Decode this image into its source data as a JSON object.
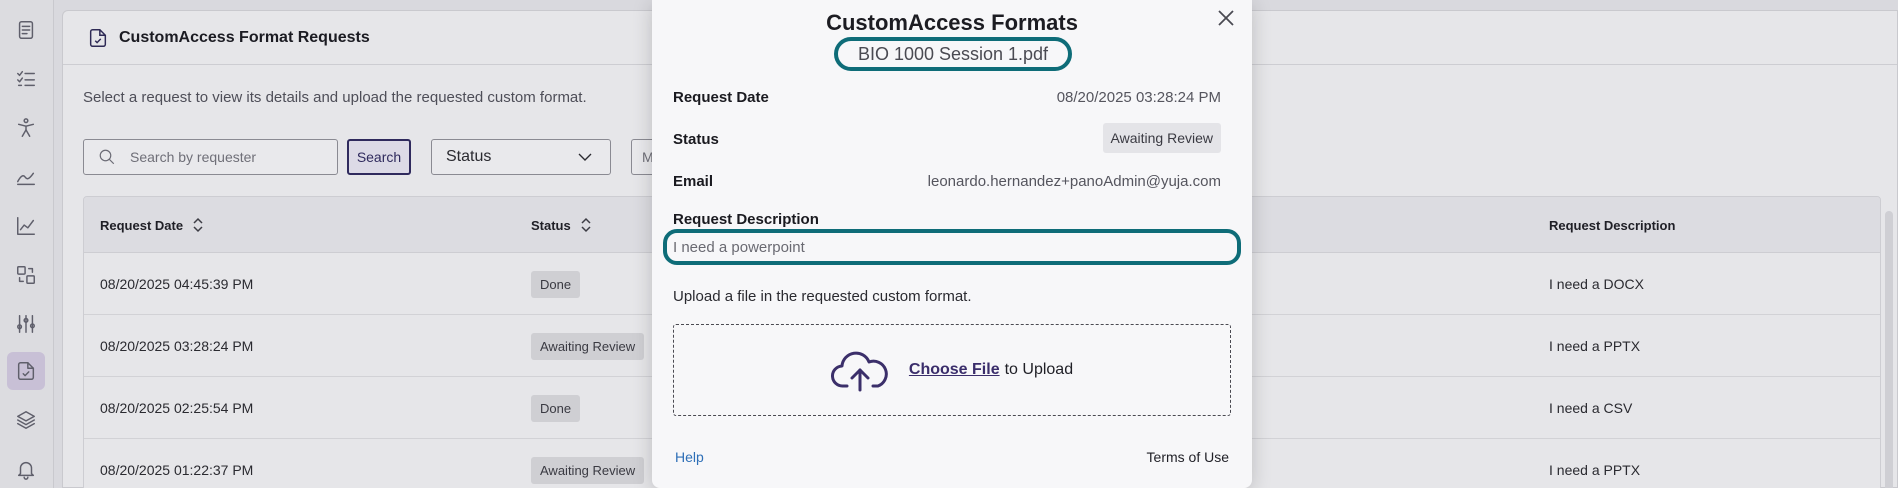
{
  "rail": {
    "items": [
      {
        "name": "document-icon"
      },
      {
        "name": "checklist-icon"
      },
      {
        "name": "accessibility-icon"
      },
      {
        "name": "signature-icon"
      },
      {
        "name": "analytics-icon"
      },
      {
        "name": "convert-icon"
      },
      {
        "name": "settings-sliders-icon"
      },
      {
        "name": "custom-format-icon",
        "active": true
      },
      {
        "name": "layers-icon"
      },
      {
        "name": "bell-icon"
      }
    ]
  },
  "panel": {
    "title": "CustomAccess Format Requests",
    "subtitle": "Select a request to view its details and upload the requested custom format.",
    "search_placeholder": "Search by requester",
    "search_button": "Search",
    "status_select": "Status",
    "more_select": "M"
  },
  "table": {
    "headers": {
      "request_date": "Request Date",
      "status": "Status",
      "request_description": "Request Description"
    },
    "rows": [
      {
        "date": "08/20/2025 04:45:39 PM",
        "status": "Done",
        "description": "I need a DOCX"
      },
      {
        "date": "08/20/2025 03:28:24 PM",
        "status": "Awaiting Review",
        "description": "I need a PPTX"
      },
      {
        "date": "08/20/2025 02:25:54 PM",
        "status": "Done",
        "description": "I need a CSV"
      },
      {
        "date": "08/20/2025 01:22:37 PM",
        "status": "Awaiting Review",
        "description": "I need a PPTX"
      }
    ]
  },
  "modal": {
    "title": "CustomAccess Formats",
    "filename": "BIO 1000 Session 1.pdf",
    "request_date_label": "Request Date",
    "request_date_value": "08/20/2025 03:28:24 PM",
    "status_label": "Status",
    "status_value": "Awaiting Review",
    "email_label": "Email",
    "email_value": "leonardo.hernandez+panoAdmin@yuja.com",
    "description_label": "Request Description",
    "description_value": "I need a powerpoint",
    "upload_hint": "Upload a file in the requested custom format.",
    "choose_file": "Choose File",
    "to_upload": "to Upload",
    "help": "Help",
    "terms": "Terms of Use"
  },
  "colors": {
    "highlight": "#0e6c78",
    "brand": "#2f2a5d",
    "link": "#2e6fb7"
  }
}
